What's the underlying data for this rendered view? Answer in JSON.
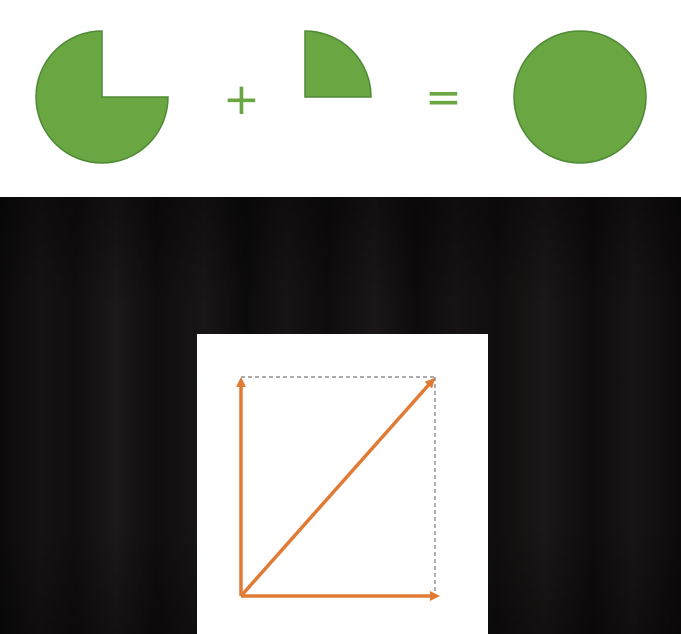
{
  "equation": {
    "plus_symbol": "+",
    "equals_symbol": "=",
    "shape_color": "#6aa642",
    "shape_outline_color": "#4f8a35"
  },
  "vector_diagram": {
    "arrow_color": "#e07b35",
    "dashed_line_color": "#7a7a7a"
  }
}
